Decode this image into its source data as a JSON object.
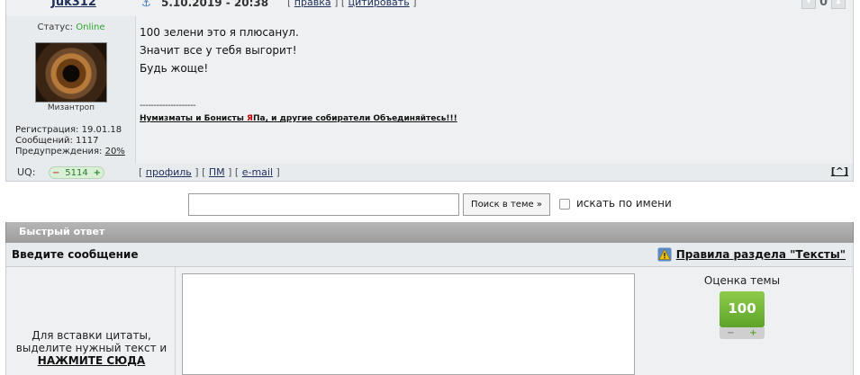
{
  "post": {
    "username": "Juk312",
    "date": "5.10.2019 - 20:38",
    "edit_link": "правка",
    "quote_link": "цитировать",
    "rating_count": "0",
    "author": {
      "status_label": "Статус:",
      "status_value": "Online",
      "title": "Мизантроп",
      "stats": {
        "registration": "Регистрация: 19.01.18",
        "messages": "Сообщений: 1117",
        "warnings_label": "Предупреждения:",
        "warnings_value": "20%"
      }
    },
    "message_lines": [
      "100 зелени это я плюсанул.",
      "Значит все у тебя выгорит!",
      "Будь жоще!"
    ],
    "signature_divider": "--------------------",
    "signature": {
      "part1": "Нумизматы и Бонисты ",
      "part2_red": "Я",
      "part3": "Па, и другие собиратели Объединяйтесь!!!"
    },
    "footer": {
      "uq_label": "UQ:",
      "uq_minus": "−",
      "uq_value": "5114",
      "uq_plus": "+",
      "profile_link": "профиль",
      "pm_link": "ПМ",
      "email_link": "e-mail",
      "to_top": "[^]"
    }
  },
  "search": {
    "input_value": "",
    "button_label": "Поиск в теме »",
    "checkbox_label": "искать по имени",
    "checkbox_checked": false
  },
  "quick_reply": {
    "title": "Быстрый ответ",
    "subheading": "Введите сообщение",
    "rules_link": "Правила раздела \"Тексты\"",
    "hint_line1": "Для вставки цитаты,",
    "hint_line2": "выделите нужный текст и",
    "hint_action": "НАЖМИТЕ СЮДА",
    "message_value": "",
    "rating_label": "Оценка темы",
    "rating_value": "100",
    "rating_minus": "−",
    "rating_plus": "+"
  },
  "icons": {
    "anchor": "anchor-icon",
    "warning": "warning-icon",
    "vote": "vote-icon"
  },
  "colors": {
    "online": "#2ea52e",
    "header_bar": "#a8a8a8",
    "rating_green": "#6fb33a",
    "signature_red": "#c00000"
  }
}
